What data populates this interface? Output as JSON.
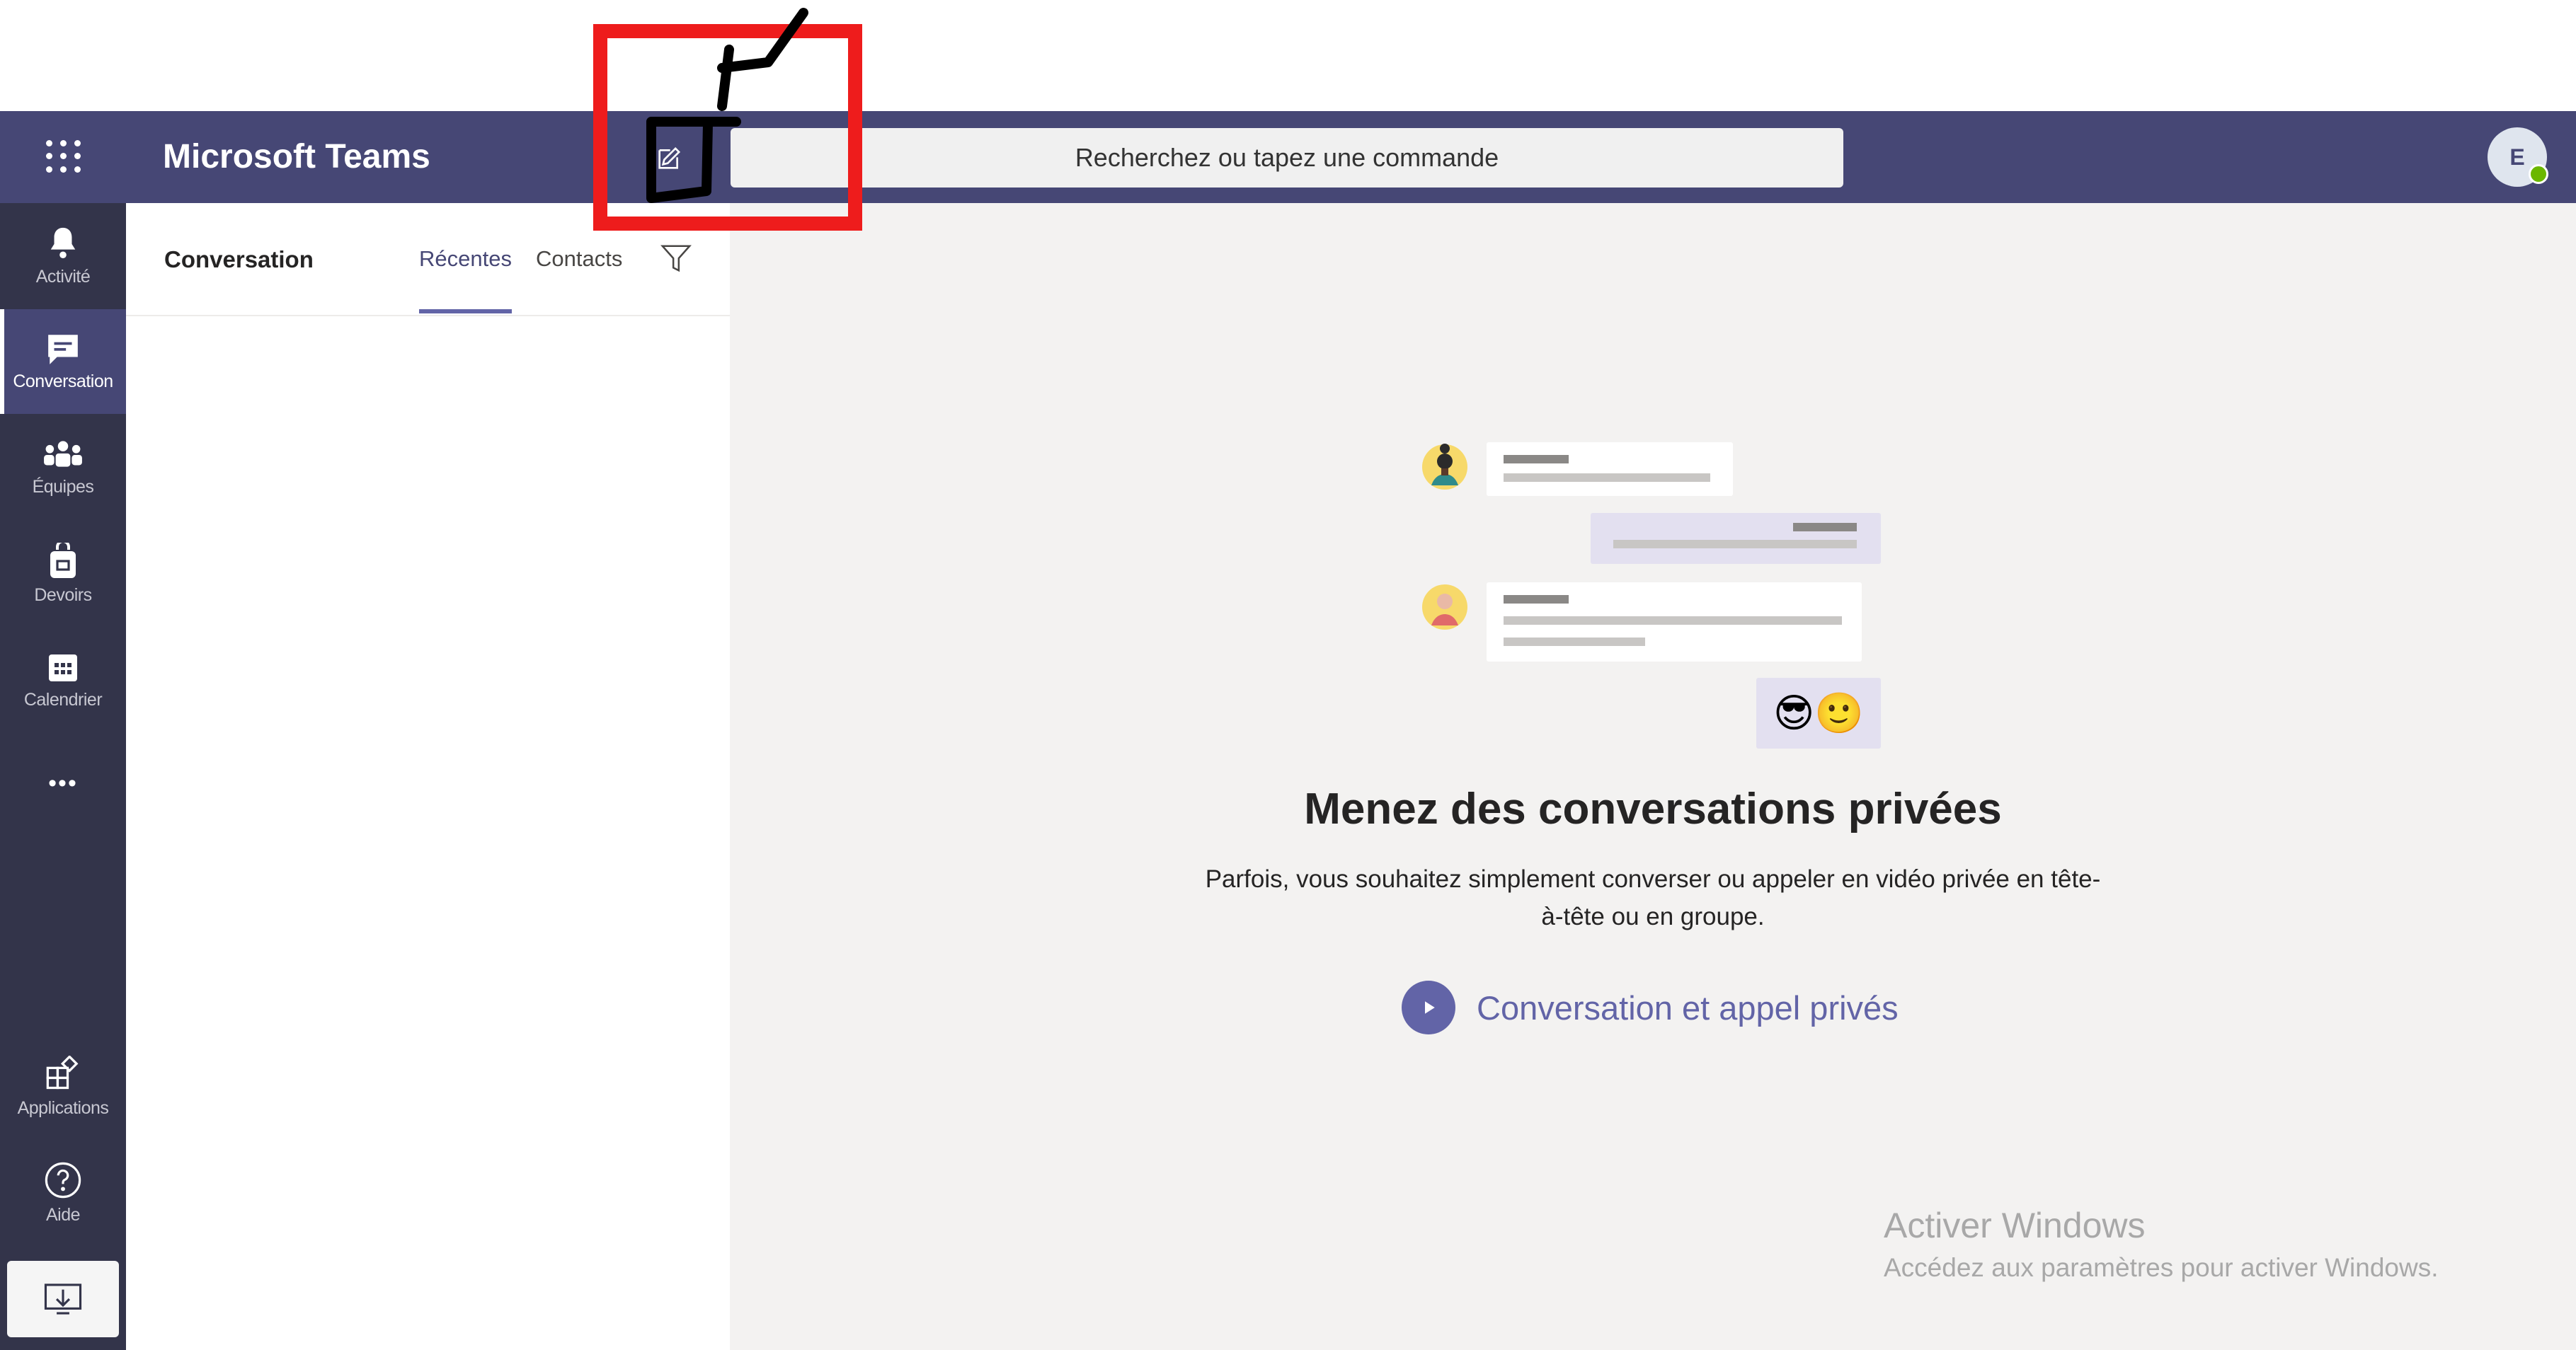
{
  "header": {
    "app_title": "Microsoft Teams",
    "search_placeholder": "Recherchez ou tapez une commande",
    "avatar_initial": "E"
  },
  "rail": {
    "items": [
      {
        "label": "Activité",
        "icon": "bell-icon"
      },
      {
        "label": "Conversation",
        "icon": "chat-icon",
        "active": true
      },
      {
        "label": "Équipes",
        "icon": "teams-icon"
      },
      {
        "label": "Devoirs",
        "icon": "assignments-icon"
      },
      {
        "label": "Calendrier",
        "icon": "calendar-icon"
      },
      {
        "label": "Applications",
        "icon": "apps-icon"
      },
      {
        "label": "Aide",
        "icon": "help-icon"
      }
    ],
    "more_label": "•••"
  },
  "list_pane": {
    "title": "Conversation",
    "tabs": [
      "Récentes",
      "Contacts"
    ],
    "active_tab": "Récentes"
  },
  "main": {
    "heading": "Menez des conversations privées",
    "description": "Parfois, vous souhaitez simplement converser ou appeler en vidéo privée en tête-à-tête ou en groupe.",
    "cta_label": "Conversation et appel privés",
    "emojis": "😎🙂"
  },
  "watermark": {
    "title": "Activer Windows",
    "subtitle": "Accédez aux paramètres pour activer Windows."
  },
  "colors": {
    "topbar": "#464775",
    "rail": "#33344a",
    "accent": "#6264a7",
    "annotation": "#ee1c1c"
  }
}
